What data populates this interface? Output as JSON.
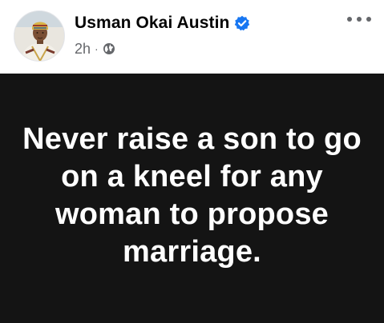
{
  "post": {
    "author_name": "Usman Okai Austin",
    "timestamp": "2h",
    "separator": "·",
    "audience_icon": "globe-icon",
    "verified_icon": "verified-badge-icon",
    "more_icon": "more-options-icon",
    "text": "Never raise a son to go on a kneel for any woman to propose marriage."
  },
  "colors": {
    "author_text": "#050505",
    "meta_text": "#65676b",
    "verified_blue": "#1877f2",
    "content_background": "#141414",
    "content_text": "#ffffff"
  }
}
